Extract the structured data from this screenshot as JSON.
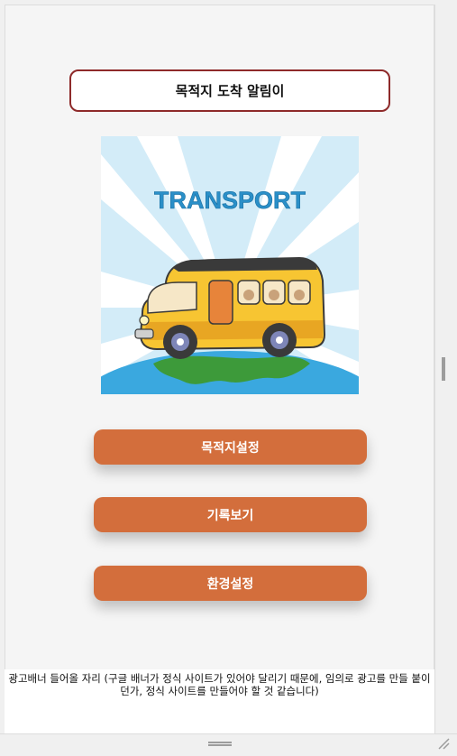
{
  "header": {
    "title": "목적지 도착 알림이"
  },
  "illustration": {
    "caption_text": "TRANSPORT",
    "icon": "school-bus-illustration"
  },
  "menu": {
    "buttons": [
      {
        "label": "목적지설정"
      },
      {
        "label": "기록보기"
      },
      {
        "label": "환경설정"
      }
    ]
  },
  "ad_banner": {
    "text": "광고배너 들어올 자리 (구글 배너가 정식 사이트가 있어야 달리기 때문에, 임의로 광고를 만들 붙이던가, 정식 사이트를 만들어야 할 것 같습니다)"
  },
  "colors": {
    "accent": "#d36e3c",
    "title_border": "#8e2a2a",
    "sky": "#d3ecf8",
    "bus_yellow": "#f7c532"
  }
}
